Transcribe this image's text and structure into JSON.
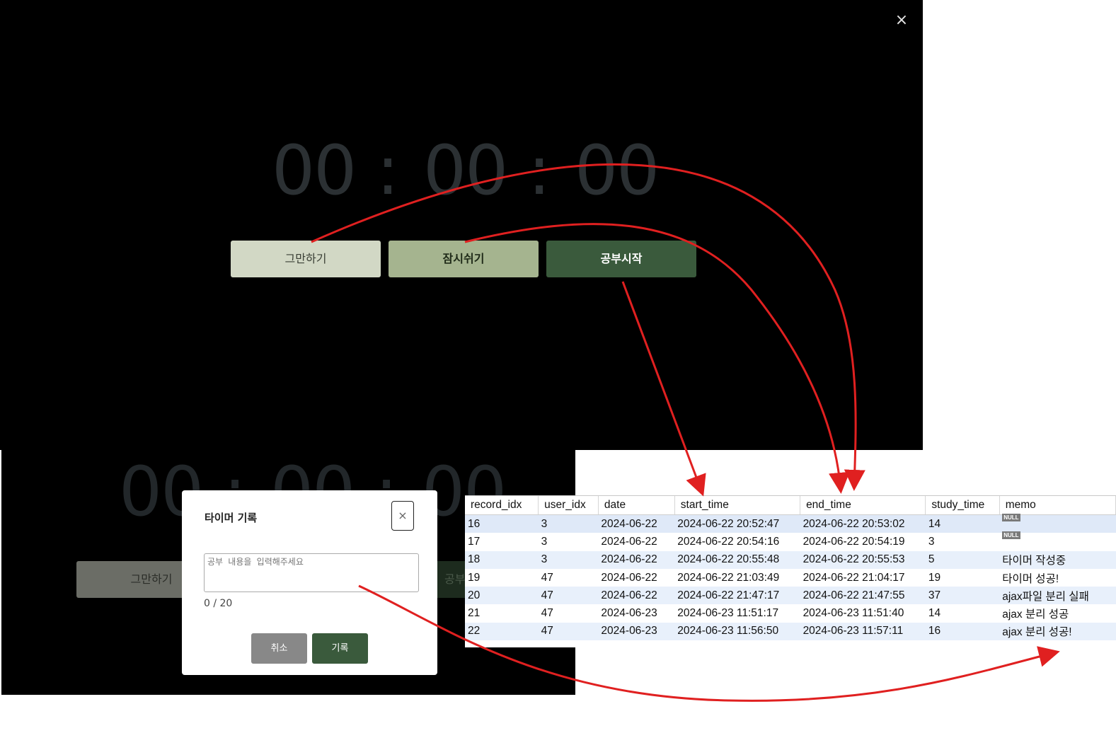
{
  "top_screen": {
    "close_icon": "×",
    "timer": {
      "hours": "00",
      "minutes": "00",
      "seconds": "00",
      "separator": ":"
    },
    "buttons": {
      "stop": "그만하기",
      "pause": "잠시쉬기",
      "start": "공부시작"
    }
  },
  "bottom_screen": {
    "timer": {
      "hours": "00",
      "minutes": "00",
      "seconds": "00",
      "separator": ":"
    },
    "buttons": {
      "stop": "그만하기",
      "start_partial": "공부"
    },
    "modal": {
      "title": "타이머 기록",
      "close_icon": "×",
      "textarea_placeholder": "공부 내용을 입력해주세요",
      "counter": "0 / 20",
      "cancel": "취소",
      "save": "기록"
    }
  },
  "db_table": {
    "columns": [
      "record_idx",
      "user_idx",
      "date",
      "start_time",
      "end_time",
      "study_time",
      "memo"
    ],
    "null_label": "NULL",
    "rows": [
      [
        "16",
        "3",
        "2024-06-22",
        "2024-06-22 20:52:47",
        "2024-06-22 20:53:02",
        "14",
        null
      ],
      [
        "17",
        "3",
        "2024-06-22",
        "2024-06-22 20:54:16",
        "2024-06-22 20:54:19",
        "3",
        null
      ],
      [
        "18",
        "3",
        "2024-06-22",
        "2024-06-22 20:55:48",
        "2024-06-22 20:55:53",
        "5",
        "타이머 작성중"
      ],
      [
        "19",
        "47",
        "2024-06-22",
        "2024-06-22 21:03:49",
        "2024-06-22 21:04:17",
        "19",
        "타이머 성공!"
      ],
      [
        "20",
        "47",
        "2024-06-22",
        "2024-06-22 21:47:17",
        "2024-06-22 21:47:55",
        "37",
        "ajax파일 분리 실패"
      ],
      [
        "21",
        "47",
        "2024-06-23",
        "2024-06-23 11:51:17",
        "2024-06-23 11:51:40",
        "14",
        "ajax 분리 성공"
      ],
      [
        "22",
        "47",
        "2024-06-23",
        "2024-06-23 11:56:50",
        "2024-06-23 11:57:11",
        "16",
        "ajax 분리 성공!"
      ]
    ]
  },
  "colors": {
    "arrow": "#e02020",
    "stop_button": "#d2d8c5",
    "pause_button": "#a5b48f",
    "start_button": "#3a5a3c",
    "cancel_button": "#888888"
  }
}
